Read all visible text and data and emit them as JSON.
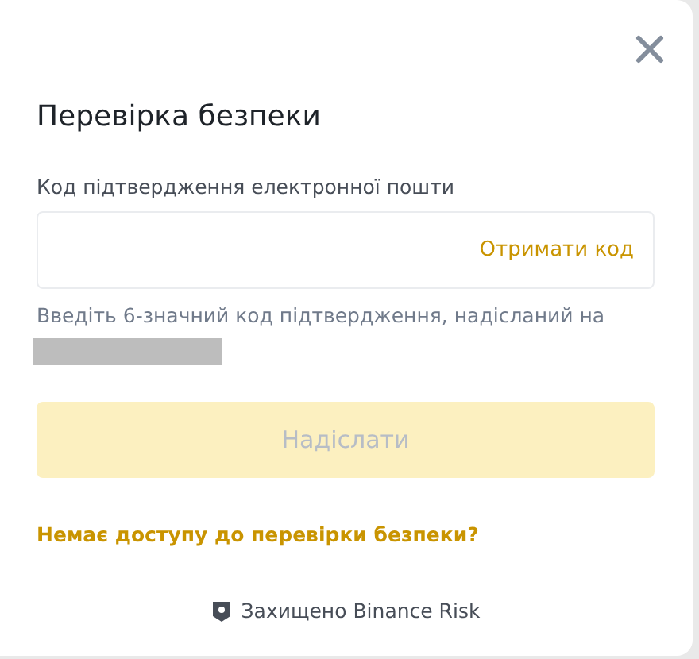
{
  "dialog": {
    "title": "Перевірка безпеки"
  },
  "code_field": {
    "label": "Код підтвердження електронної пошти",
    "action": "Отримати код",
    "hint": "Введіть 6-значний код підтвердження, надісланий на"
  },
  "submit_button": {
    "label": "Надіслати",
    "disabled": true
  },
  "help_link": "Немає доступу до перевірки безпеки?",
  "footer": "Захищено Binance Risk"
}
